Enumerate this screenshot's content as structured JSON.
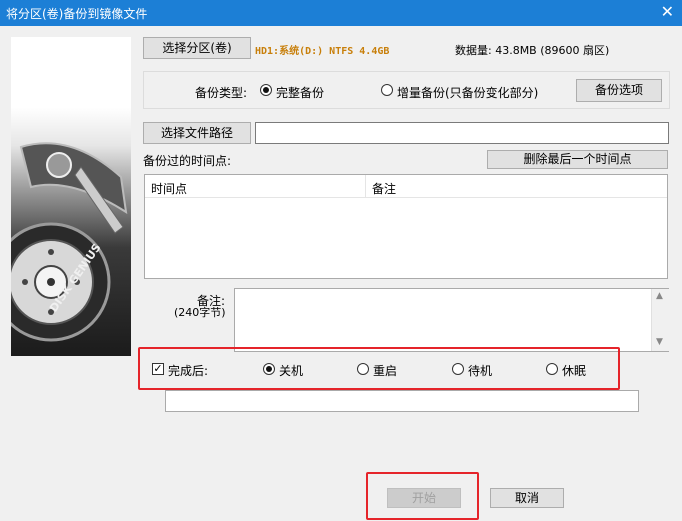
{
  "window": {
    "title": "将分区(卷)备份到镜像文件",
    "close_glyph": "✕"
  },
  "banner": {
    "brand_text": "DISK GENIUS"
  },
  "partition": {
    "select_label": "选择分区(卷)",
    "info": "HD1:系统(D:) NTFS 4.4GB",
    "data_size": "数据量: 43.8MB (89600 扇区)"
  },
  "backup_type": {
    "label": "备份类型:",
    "options": [
      {
        "label": "完整备份",
        "selected": true
      },
      {
        "label": "增量备份(只备份变化部分)",
        "selected": false
      }
    ],
    "options_button": "备份选项"
  },
  "file_path": {
    "select_label": "选择文件路径",
    "value": ""
  },
  "timepoints": {
    "label": "备份过的时间点:",
    "delete_button": "删除最后一个时间点",
    "columns": [
      "时间点",
      "备注"
    ],
    "rows": []
  },
  "note": {
    "label": "备注:",
    "sublabel": "(240字节)",
    "value": ""
  },
  "after_complete": {
    "checked": true,
    "label": "完成后:",
    "options": [
      {
        "label": "关机",
        "selected": true
      },
      {
        "label": "重启",
        "selected": false
      },
      {
        "label": "待机",
        "selected": false
      },
      {
        "label": "休眠",
        "selected": false
      }
    ]
  },
  "progress_text": "",
  "buttons": {
    "start": "开始",
    "cancel": "取消"
  },
  "colors": {
    "titlebar": "#1c7fd6",
    "highlight": "#e5242a",
    "partition_text": "#c87f0a"
  }
}
